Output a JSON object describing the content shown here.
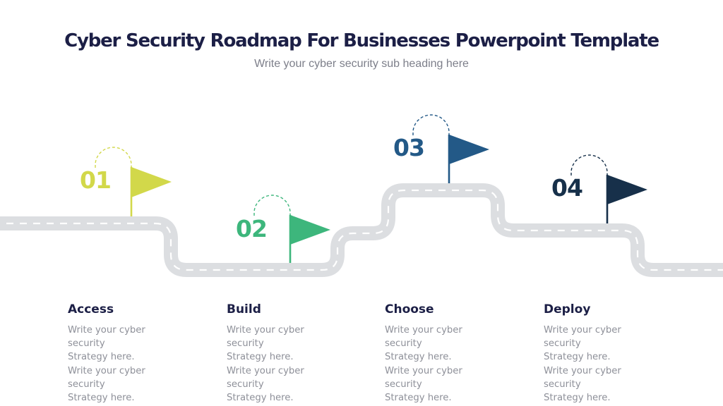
{
  "slide": {
    "title": "Cyber Security Roadmap For Businesses Powerpoint Template",
    "subtitle": "Write your cyber security sub heading here"
  },
  "colors": {
    "title": "#1c1f46",
    "subtitle": "#7d7f8a",
    "road": "#dcdee1",
    "road_dash": "#ffffff",
    "body_text": "#8e9099"
  },
  "milestones": [
    {
      "number": "01",
      "color": "#d2d84a",
      "icon": "flag-icon",
      "heading": "Access",
      "lines": [
        "Write your cyber",
        "security",
        "Strategy here.",
        "Write your cyber",
        "security",
        "Strategy here."
      ]
    },
    {
      "number": "02",
      "color": "#3db67c",
      "icon": "flag-icon",
      "heading": "Build",
      "lines": [
        "Write your cyber",
        "security",
        "Strategy here.",
        "Write your cyber",
        "security",
        "Strategy here."
      ]
    },
    {
      "number": "03",
      "color": "#235987",
      "icon": "flag-icon",
      "heading": "Choose",
      "lines": [
        "Write your cyber",
        "security",
        "Strategy here.",
        "Write your cyber",
        "security",
        "Strategy here."
      ]
    },
    {
      "number": "04",
      "color": "#17304a",
      "icon": "flag-icon",
      "heading": "Deploy",
      "lines": [
        "Write your cyber",
        "security",
        "Strategy here.",
        "Write your cyber",
        "security",
        "Strategy here."
      ]
    }
  ]
}
